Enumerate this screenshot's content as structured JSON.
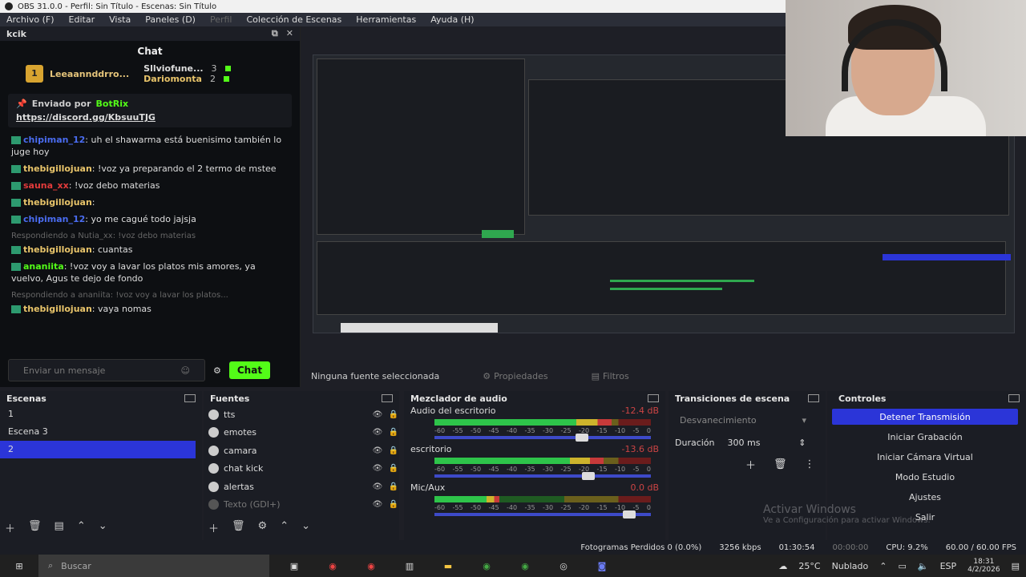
{
  "window": {
    "title": "OBS 31.0.0 - Perfil: Sin Título - Escenas: Sin Título"
  },
  "menu": [
    "Archivo (F)",
    "Editar",
    "Vista",
    "Paneles (D)",
    "Perfil",
    "Colección de Escenas",
    "Herramientas",
    "Ayuda (H)"
  ],
  "chat_dock": {
    "header": "kcik",
    "title": "Chat",
    "leader_top": "Leeaannddrro...",
    "leaders": [
      {
        "name": "Sllviofune...",
        "count": "3"
      },
      {
        "name": "Dariomonta",
        "count": "2"
      }
    ],
    "pinned_by_label": "Enviado por",
    "pinned_bot": "BotRix",
    "pinned_link": "https://discord.gg/KbsuuTJG",
    "messages": [
      {
        "user": "chipiman_12",
        "text": ": uh el shawarma está buenisimo también lo juge hoy",
        "color": "#4a6cf0"
      },
      {
        "user": "thebigillojuan",
        "text": ": !voz ya preparando el 2 termo de mstee",
        "color": "#e8c46a"
      },
      {
        "user": "sauna_xx",
        "text": ": !voz debo materias",
        "color": "#e23b3b"
      },
      {
        "user": "thebigillojuan",
        "text": ":",
        "color": "#e8c46a"
      },
      {
        "user": "chipiman_12",
        "text": ": yo me cagué todo jajsja",
        "color": "#4a6cf0"
      },
      {
        "reply": "Respondiendo a Nutia_xx: !voz debo materias"
      },
      {
        "user": "thebigillojuan",
        "text": ": cuantas",
        "color": "#e8c46a"
      },
      {
        "user": "ananiita",
        "text": ": !voz voy a lavar los platos mis amores, ya vuelvo, Agus te dejo de fondo",
        "color": "#53fc18"
      },
      {
        "reply": "Respondiendo a ananiita: !voz voy a lavar los platos..."
      },
      {
        "user": "thebigillojuan",
        "text": ": vaya nomas",
        "color": "#e8c46a"
      }
    ],
    "input_placeholder": "Enviar un mensaje",
    "send_label": "Chat"
  },
  "source_bar": {
    "none_selected": "Ninguna fuente seleccionada",
    "properties": "Propiedades",
    "filters": "Filtros"
  },
  "scenes": {
    "title": "Escenas",
    "items": [
      "1",
      "Escena 3",
      "2"
    ],
    "selected_index": 2
  },
  "sources": {
    "title": "Fuentes",
    "items": [
      "tts",
      "emotes",
      "camara",
      "chat kick",
      "alertas",
      "Texto (GDI+)"
    ]
  },
  "mixer": {
    "title": "Mezclador de audio",
    "channels": [
      {
        "name": "Audio del escritorio",
        "db": "-12.4 dB",
        "level": 0.82,
        "volume": 0.68
      },
      {
        "name": "escritorio",
        "db": "-13.6 dB",
        "level": 0.78,
        "volume": 0.71
      },
      {
        "name": "Mic/Aux",
        "db": "0.0 dB",
        "level": 0.3,
        "volume": 0.9
      }
    ],
    "scale": [
      "-60",
      "-55",
      "-50",
      "-45",
      "-40",
      "-35",
      "-30",
      "-25",
      "-20",
      "-15",
      "-10",
      "-5",
      "0"
    ]
  },
  "transitions": {
    "title": "Transiciones de escena",
    "selected": "Desvanecimiento",
    "duration_label": "Duración",
    "duration_value": "300 ms"
  },
  "controls": {
    "title": "Controles",
    "buttons": [
      "Detener Transmisión",
      "Iniciar Grabación",
      "Iniciar Cámara Virtual",
      "Modo Estudio",
      "Ajustes",
      "Salir"
    ]
  },
  "watermark": {
    "line1": "Activar Windows",
    "line2": "Ve a Configuración para activar Windows."
  },
  "status": {
    "dropped": "Fotogramas Perdidos 0 (0.0%)",
    "bitrate": "3256 kbps",
    "live_time": "01:30:54",
    "rec_time": "00:00:00",
    "cpu": "CPU: 9.2%",
    "fps": "60.00 / 60.00 FPS"
  },
  "taskbar": {
    "search": "Buscar",
    "weather_temp": "25°C",
    "weather_text": "Nublado",
    "lang": "ESP",
    "time": "18:31",
    "date": "4/2/2026"
  },
  "colors": {
    "accent": "#2b35d8",
    "kick_green": "#53fc18"
  }
}
